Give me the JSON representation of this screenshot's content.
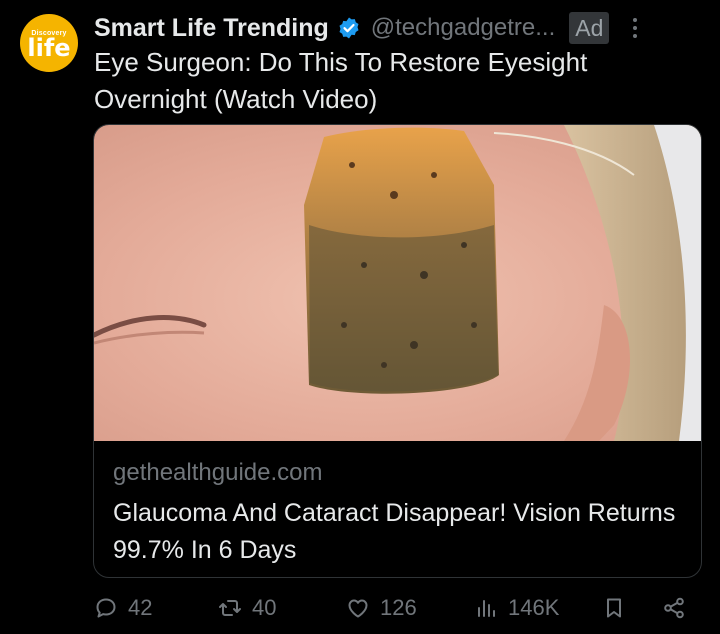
{
  "author": {
    "avatar_small": "Discovery",
    "avatar_big": "life",
    "name": "Smart Life Trending",
    "handle": "@techgadgetre...",
    "ad_label": "Ad"
  },
  "tweet": {
    "text": "Eye Surgeon: Do This To Restore Eyesight Overnight (Watch Video)"
  },
  "card": {
    "domain": "gethealthguide.com",
    "title": "Glaucoma And Cataract Disappear! Vision Returns 99.7% In 6 Days"
  },
  "actions": {
    "replies": "42",
    "reposts": "40",
    "likes": "126",
    "views": "146K"
  },
  "colors": {
    "background": "#000000",
    "text": "#e7e9ea",
    "muted": "#71767b",
    "verified": "#1d9bf0",
    "avatar": "#f5b400"
  },
  "icons": [
    "verified-badge-icon",
    "more-icon",
    "reply-icon",
    "repost-icon",
    "like-icon",
    "views-icon",
    "bookmark-icon",
    "share-icon"
  ]
}
